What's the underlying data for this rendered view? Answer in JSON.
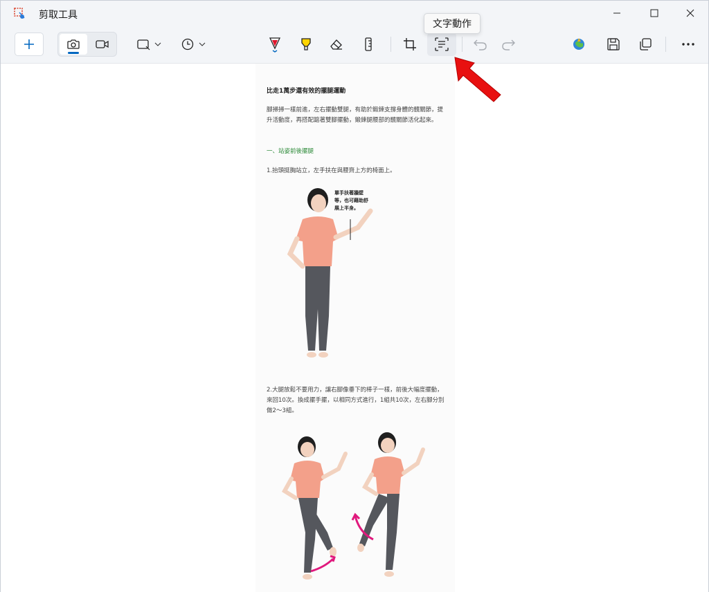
{
  "window": {
    "title": "剪取工具"
  },
  "toolbar": {
    "new_icon": "plus-icon",
    "modes": [
      "camera-icon",
      "video-icon"
    ],
    "shape_icon": "rectangle-snip-icon",
    "delay_icon": "clock-icon",
    "tools": [
      "ballpoint-pen-icon",
      "highlighter-icon",
      "eraser-icon",
      "ruler-icon",
      "crop-icon",
      "text-actions-icon",
      "undo-icon",
      "redo-icon",
      "paint-icon",
      "save-icon",
      "copy-icon",
      "more-icon"
    ]
  },
  "tooltip": {
    "text": "文字動作"
  },
  "colors": {
    "accent": "#0067c0",
    "arrow": "#e81010",
    "shirt": "#f3a08a",
    "pants": "#55575d"
  },
  "doc": {
    "title": "比走1萬步還有效的擺腿運動",
    "intro": "腳掃掃一樣前進，左右擺動雙腿，有助於鍛鍊支撐身體的髖關節，提升活動度，再搭配踮著雙腳擺動，鍛鍊腿腰部的髖關節活化起來。",
    "section": "一、站姿前後擺腿",
    "step1": "1.抬頭挺胸站立，左手扶在與腰齊上方的椅面上。",
    "callout": "單手扶著牆壁等，也可藉助舒展上半身。",
    "step2": "2.大腿放鬆不要用力，讓右腳像垂下的棒子一樣，前後大幅度擺動，來回10次。換成擺手擺，以相同方式進行，1組共10次，左右腳分別做2～3組。"
  }
}
